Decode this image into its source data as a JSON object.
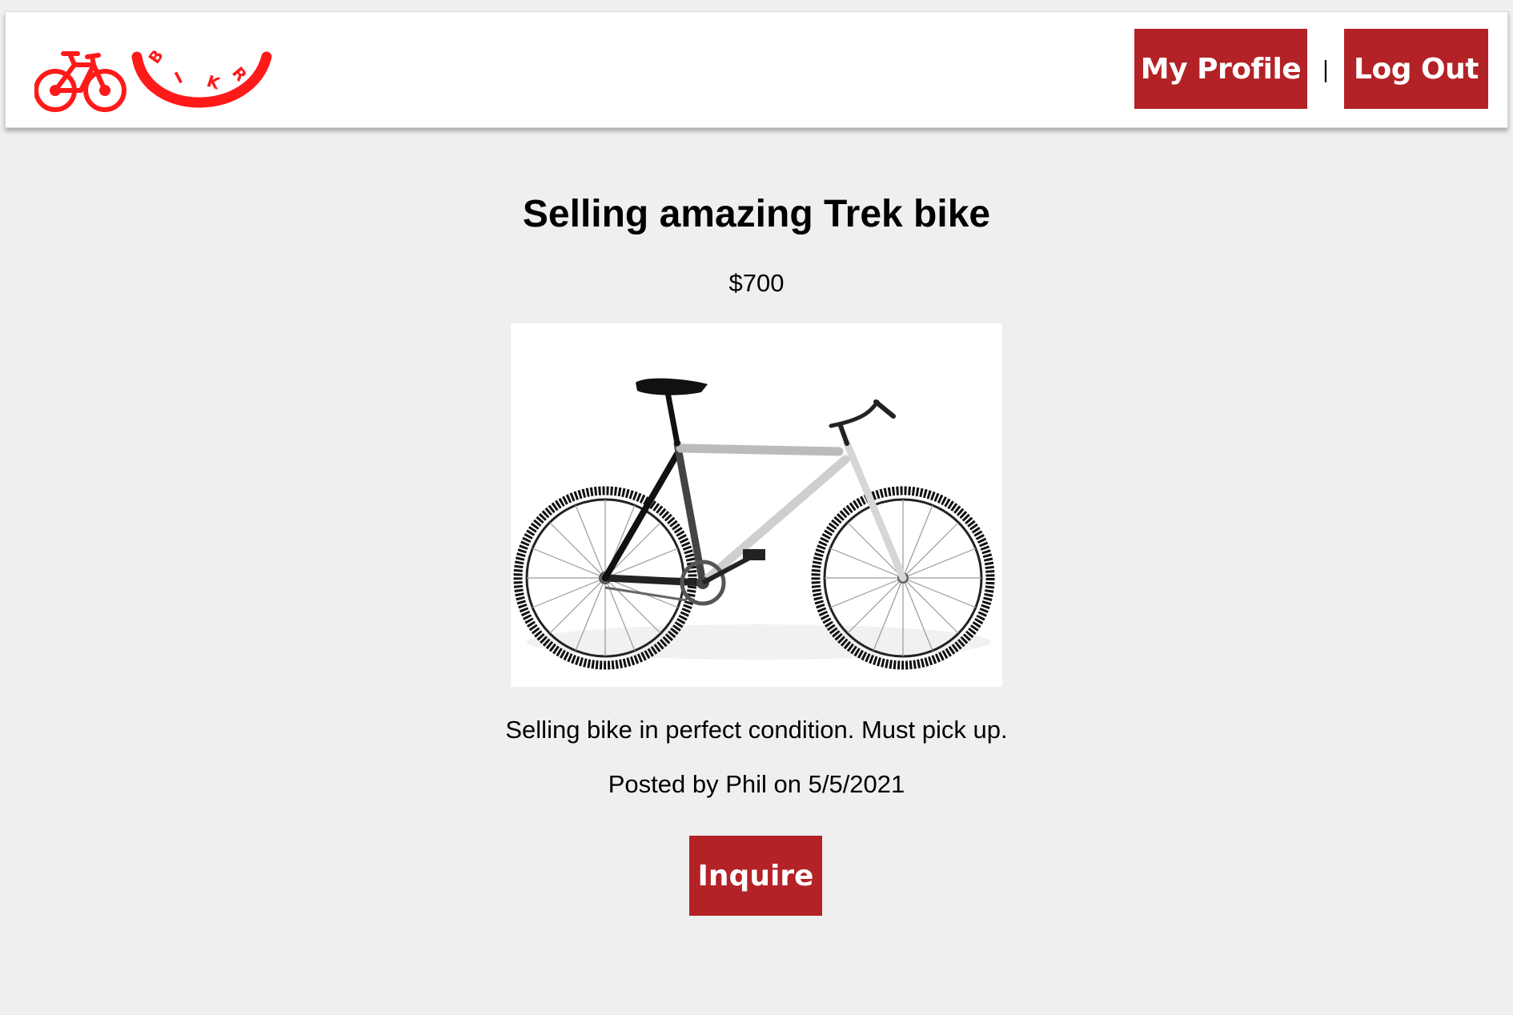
{
  "brand": {
    "logo_text": "BIKR",
    "accent_color": "#b32226",
    "logo_color": "#ff1a1a"
  },
  "nav": {
    "profile_label": "My Profile",
    "separator": "|",
    "logout_label": "Log Out"
  },
  "listing": {
    "title": "Selling amazing Trek bike",
    "price": "$700",
    "image_alt": "bicycle-photo",
    "description": "Selling bike in perfect condition. Must pick up.",
    "posted": "Posted by Phil on 5/5/2021",
    "inquire_label": "Inquire"
  }
}
